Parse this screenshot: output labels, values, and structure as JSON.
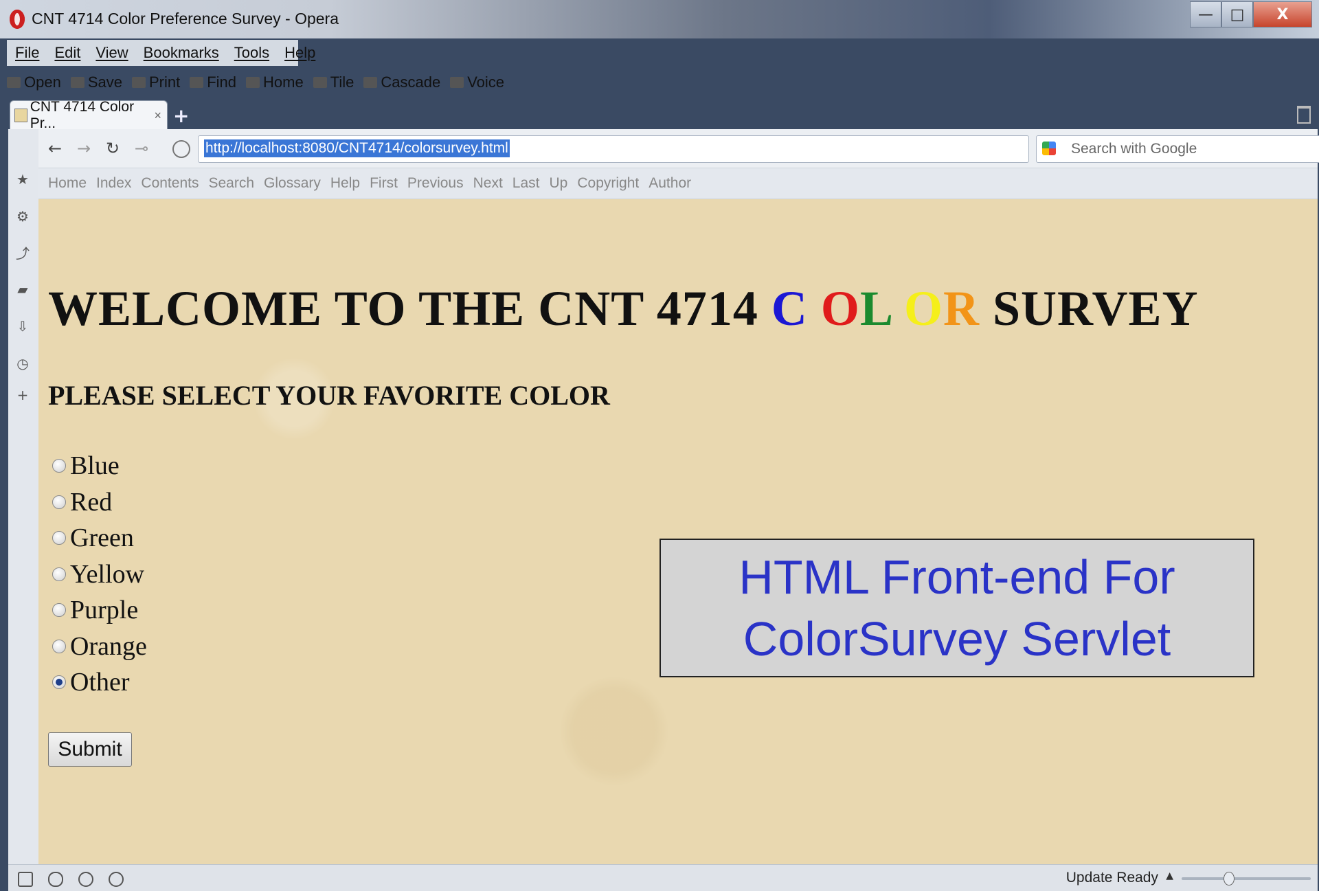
{
  "window": {
    "title": "CNT 4714 Color Preference Survey - Opera",
    "minimize": "—",
    "maximize": "□",
    "close": "X"
  },
  "menu": [
    "File",
    "Edit",
    "View",
    "Bookmarks",
    "Tools",
    "Help"
  ],
  "toolbar": [
    "Open",
    "Save",
    "Print",
    "Find",
    "Home",
    "Tile",
    "Cascade",
    "Voice"
  ],
  "tab": {
    "label": "CNT 4714 Color Pr...",
    "close": "×",
    "new_tab": "+"
  },
  "address": {
    "url": "http://localhost:8080/CNT4714/colorsurvey.html",
    "search_placeholder": "Search with Google"
  },
  "nav_links": [
    "Home",
    "Index",
    "Contents",
    "Search",
    "Glossary",
    "Help",
    "First",
    "Previous",
    "Next",
    "Last",
    "Up",
    "Copyright",
    "Author"
  ],
  "page": {
    "welcome_prefix": "WELCOME TO THE CNT 4714 ",
    "color_letters": [
      {
        "ch": "C",
        "color": "#1b17d4"
      },
      {
        "ch": " ",
        "color": "#111111"
      },
      {
        "ch": "O",
        "color": "#e01b1b"
      },
      {
        "ch": "L",
        "color": "#1b8a2e"
      },
      {
        "ch": " ",
        "color": "#111111"
      },
      {
        "ch": "O",
        "color": "#f5ef1a"
      },
      {
        "ch": "R",
        "color": "#f29418"
      }
    ],
    "welcome_suffix": " SURVEY",
    "subheading": "PLEASE SELECT YOUR FAVORITE COLOR",
    "options": [
      {
        "label": "Blue",
        "checked": false
      },
      {
        "label": "Red",
        "checked": false
      },
      {
        "label": "Green",
        "checked": false
      },
      {
        "label": "Yellow",
        "checked": false
      },
      {
        "label": "Purple",
        "checked": false
      },
      {
        "label": "Orange",
        "checked": false
      },
      {
        "label": "Other",
        "checked": true
      }
    ],
    "submit_label": "Submit"
  },
  "callout": {
    "line1": "HTML Front-end For",
    "line2": "ColorSurvey Servlet"
  },
  "status": {
    "text": "Update Ready",
    "zoom_fraction": 0.35
  }
}
